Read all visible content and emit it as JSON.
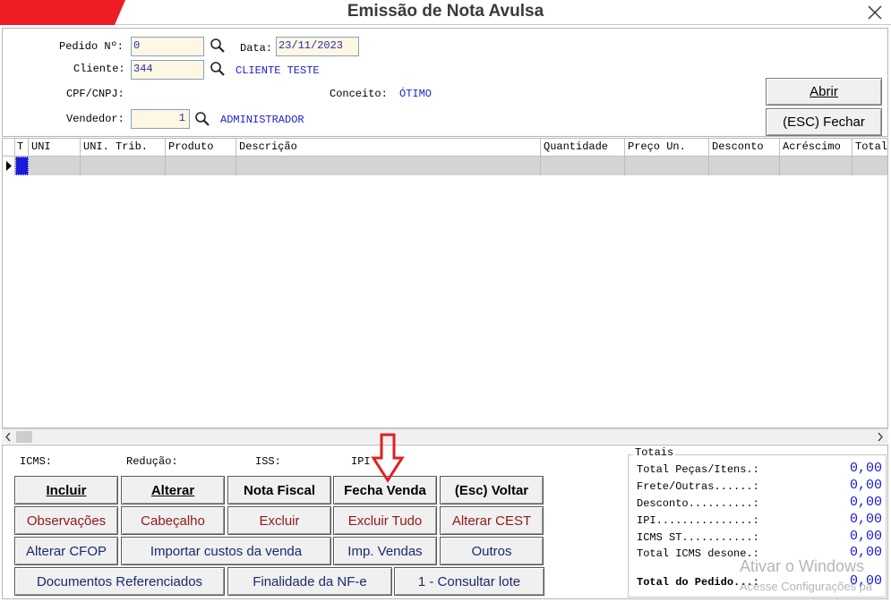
{
  "window": {
    "title": "Emissão de Nota Avulsa",
    "accent_color": "#ee1c25"
  },
  "header": {
    "pedido_label": "Pedido Nº:",
    "pedido_value": "0",
    "data_label": "Data:",
    "data_value": "23/11/2023",
    "cliente_label": "Cliente:",
    "cliente_value": "344",
    "cliente_name": "CLIENTE TESTE",
    "cpf_label": "CPF/CNPJ:",
    "conceito_label": "Conceito:",
    "conceito_value": "ÓTIMO",
    "vendedor_label": "Vendedor:",
    "vendedor_value": "1",
    "vendedor_name": "ADMINISTRADOR",
    "abrir_label": "Abrir",
    "fechar_label": "(ESC) Fechar"
  },
  "grid": {
    "columns": [
      "T",
      "UNI",
      "UNI. Trib.",
      "Produto",
      "Descrição",
      "Quantidade",
      "Preço Un.",
      "Desconto",
      "Acréscimo",
      "Total"
    ]
  },
  "taxes": {
    "icms": "ICMS:",
    "reducao": "Redução:",
    "iss": "ISS:",
    "ipi": "IPI"
  },
  "actions": {
    "incluir": "Incluir",
    "alterar": "Alterar",
    "nota_fiscal": "Nota Fiscal",
    "fecha_venda": "Fecha Venda",
    "esc_voltar": "(Esc) Voltar",
    "observacoes": "Observações",
    "cabecalho": "Cabeçalho",
    "excluir": "Excluir",
    "excluir_tudo": "Excluir Tudo",
    "alterar_cest": "Alterar CEST",
    "alterar_cfop": "Alterar CFOP",
    "importar_custos": "Importar custos da venda",
    "imp_vendas": "Imp. Vendas",
    "outros": "Outros",
    "documentos_ref": "Documentos Referenciados",
    "finalidade": "Finalidade da NF-e",
    "consultar_lote": "1 - Consultar lote"
  },
  "totals": {
    "legend": "Totais",
    "rows": [
      {
        "label": "Total Peças/Itens.:",
        "value": "0,00"
      },
      {
        "label": "Frete/Outras......:",
        "value": "0,00"
      },
      {
        "label": "Desconto..........:",
        "value": "0,00"
      },
      {
        "label": "IPI...............:",
        "value": "0,00"
      },
      {
        "label": "ICMS ST...........:",
        "value": "0,00"
      },
      {
        "label": "Total ICMS desone.:",
        "value": "0,00"
      }
    ],
    "total_label": "Total do Pedido...:",
    "total_value": "0,00"
  },
  "watermark": {
    "line1": "Ativar o Windows",
    "line2": "Acesse Configurações pa"
  },
  "annotation": {
    "arrow_color": "#e02020"
  }
}
